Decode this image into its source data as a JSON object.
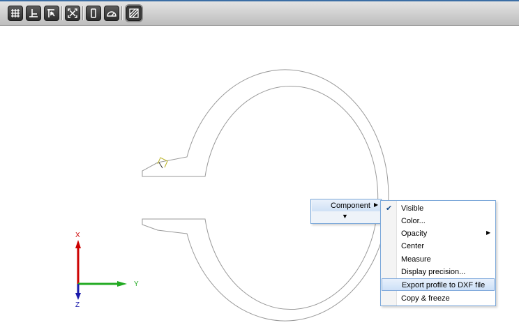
{
  "toolbar": {
    "buttons": [
      {
        "name": "grid-icon",
        "active": false
      },
      {
        "name": "perpendicular-icon",
        "active": false
      },
      {
        "name": "select-arrow-icon",
        "active": false
      },
      {
        "name": "fit-view-icon",
        "active": false
      },
      {
        "name": "column-view-icon",
        "active": false
      },
      {
        "name": "protractor-icon",
        "active": false
      },
      {
        "name": "hatch-icon",
        "active": true
      }
    ]
  },
  "axes": {
    "x_label": "X",
    "y_label": "Y",
    "z_label": "Z",
    "x_color": "#cc0000",
    "y_color": "#22aa22",
    "z_color": "#1a1aaa"
  },
  "popup": {
    "component_label": "Component",
    "submenu_arrow": "▶",
    "expand_arrow": "▼"
  },
  "context_menu": {
    "items": [
      {
        "label": "Visible",
        "checked": true,
        "submenu": false,
        "highlighted": false
      },
      {
        "label": "Color...",
        "checked": false,
        "submenu": false,
        "highlighted": false
      },
      {
        "label": "Opacity",
        "checked": false,
        "submenu": true,
        "highlighted": false
      },
      {
        "label": "Center",
        "checked": false,
        "submenu": false,
        "highlighted": false
      },
      {
        "label": "Measure",
        "checked": false,
        "submenu": false,
        "highlighted": false
      },
      {
        "label": "Display precision...",
        "checked": false,
        "submenu": false,
        "highlighted": false
      },
      {
        "label": "Export profile to DXF file",
        "checked": false,
        "submenu": false,
        "highlighted": true
      },
      {
        "label": "Copy & freeze",
        "checked": false,
        "submenu": false,
        "highlighted": false
      }
    ],
    "check_glyph": "✔",
    "submenu_glyph": "▶"
  },
  "colors": {
    "menu_border": "#7aa7d9",
    "profile_stroke": "#9a9a9a"
  }
}
